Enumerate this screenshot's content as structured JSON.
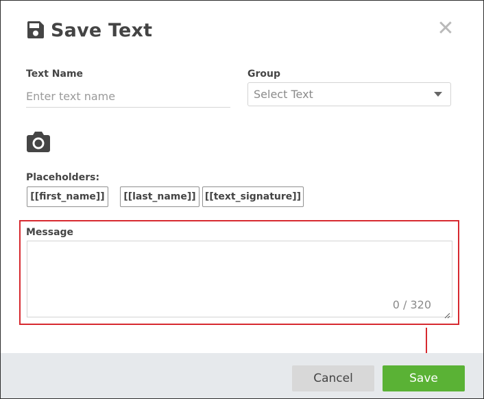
{
  "dialog": {
    "title": "Save Text",
    "title_icon": "floppy-disk-icon",
    "close_icon": "close-icon",
    "close_glyph": "✕"
  },
  "form": {
    "text_name": {
      "label": "Text Name",
      "placeholder": "Enter text name",
      "value": ""
    },
    "group": {
      "label": "Group",
      "selected": "Select Text",
      "caret_icon": "caret-down-icon"
    },
    "camera_icon": "camera-icon",
    "placeholders": {
      "label": "Placeholders:",
      "items": [
        "[[first_name]]",
        "[[last_name]]",
        "[[text_signature]]"
      ]
    },
    "message": {
      "label": "Message",
      "value": "",
      "counter": "0 / 320"
    }
  },
  "footer": {
    "cancel_label": "Cancel",
    "save_label": "Save"
  },
  "colors": {
    "highlight": "#d6282e",
    "save_button": "#5ab235",
    "cancel_button": "#d8d8d8",
    "footer_bg": "#e6e9ec"
  }
}
